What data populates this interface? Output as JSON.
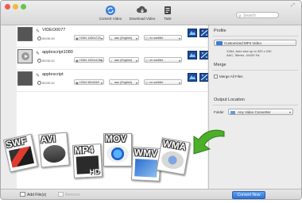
{
  "toolbar": {
    "convert_label": "Convert Video",
    "download_label": "Download Video",
    "task_label": "Task",
    "search_placeholder": "Search"
  },
  "files": [
    {
      "name": "VIDEO0077",
      "duration": "00:00:19",
      "video": "H264 1280x720",
      "audio": "aac (English)",
      "subtitle": "no subtitle"
    },
    {
      "name": "applescript1080",
      "duration": "00:00:12",
      "video": "H264 1920x1080",
      "audio": "aac (English)",
      "subtitle": "no subtitle"
    },
    {
      "name": "applescript",
      "duration": "00:00:12",
      "video": "H264 960x540",
      "audio": "aac (English)",
      "subtitle": "no subtitle"
    }
  ],
  "panel": {
    "profile_heading": "Profile",
    "profile_value": "Customized MP4 Video",
    "profile_desc_1": "X264, Auto size up to 320 x 240",
    "profile_desc_2": "AAC, Stereo, 44100 Hz",
    "merge_heading": "Merge",
    "merge_label": "Merge All Files",
    "output_heading": "Output Location",
    "folder_label": "Folder",
    "folder_value": "Any Video Converter"
  },
  "bottom": {
    "add_label": "Add File(s)",
    "remove_label": "Remove",
    "convert_label": "Convert Now"
  },
  "formats": [
    "SWF",
    "AVI",
    "MP4",
    "MOV",
    "WMV",
    "WMA"
  ],
  "formats_extra": {
    "hd": "HD"
  },
  "colors": {
    "accent": "#2f72d6",
    "arrow": "#4caf2a"
  }
}
